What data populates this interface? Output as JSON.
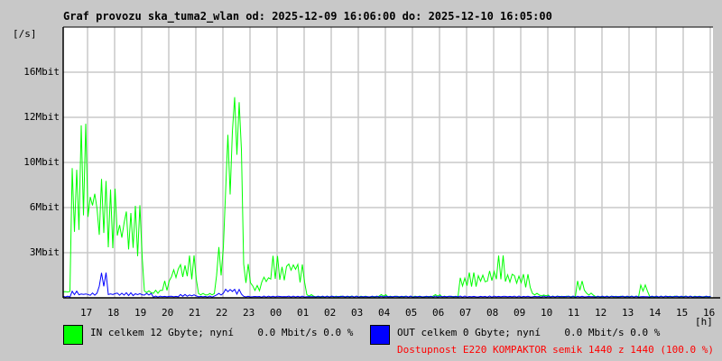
{
  "title": "Graf provozu ska_tuma2_wlan od: 2025-12-09 16:06:00 do: 2025-12-10 16:05:00",
  "colors": {
    "in": "#00ff00",
    "out": "#0000ff",
    "availability": "#ff0000",
    "grid": "#c8c8c8",
    "plot_bg": "#ffffff"
  },
  "chart_data": {
    "type": "line",
    "title": "Graf provozu ska_tuma2_wlan od: 2025-12-09 16:06:00 do: 2025-12-10 16:05:00",
    "ylabel": "[/s]",
    "xlabel": "[h]",
    "ylim": [
      0,
      20
    ],
    "x_tick_labels": [
      "17",
      "18",
      "19",
      "20",
      "21",
      "22",
      "23",
      "00",
      "01",
      "02",
      "03",
      "04",
      "05",
      "06",
      "07",
      "08",
      "09",
      "10",
      "11",
      "12",
      "13",
      "14",
      "15",
      "16"
    ],
    "y_ticks": [
      {
        "label": "3Mbit",
        "value": 3.33
      },
      {
        "label": "6Mbit",
        "value": 6.67
      },
      {
        "label": "10Mbit",
        "value": 10
      },
      {
        "label": "12Mbit",
        "value": 13.33
      },
      {
        "label": "16Mbit",
        "value": 16.67
      }
    ],
    "bin_minutes": 20,
    "grid": true,
    "series": [
      {
        "name": "IN",
        "unit": "Mbit/s",
        "values": [
          0.5,
          8,
          10.5,
          8,
          7.5,
          6.5,
          5.5,
          5.5,
          5.5,
          0.5,
          0.5,
          1,
          2,
          2.2,
          2.5,
          0.3,
          0.3,
          3,
          11,
          14,
          2,
          0.8,
          1.5,
          2.5,
          2,
          2.5,
          2,
          0.2,
          0.1,
          0.1,
          0.1,
          0.1,
          0.1,
          0.1,
          0.1,
          0.2,
          0.1,
          0.1,
          0.1,
          0.1,
          0.1,
          0.2,
          0.1,
          0.1,
          1.3,
          1.5,
          1.6,
          1.8,
          2.5,
          1.6,
          1.5,
          1.4,
          0.3,
          0.2,
          0.1,
          0.1,
          0.1,
          1,
          0.3,
          0.1,
          0.1,
          0.1,
          0.1,
          0.1,
          0.8,
          0.1,
          0.1,
          0.1,
          0.1,
          0.1,
          0.1,
          0.1
        ]
      },
      {
        "name": "OUT",
        "unit": "Mbit/s",
        "values": [
          0.1,
          0.4,
          0.3,
          0.3,
          1.5,
          0.3,
          0.3,
          0.3,
          0.3,
          0.3,
          0.1,
          0.1,
          0.1,
          0.2,
          0.2,
          0.1,
          0.1,
          0.3,
          0.6,
          0.5,
          0.1,
          0.1,
          0.1,
          0.1,
          0.1,
          0.1,
          0.1,
          0.1,
          0.1,
          0.1,
          0.1,
          0.1,
          0.1,
          0.1,
          0.1,
          0.1,
          0.1,
          0.1,
          0.1,
          0.1,
          0.1,
          0.1,
          0.1,
          0.1,
          0.1,
          0.1,
          0.1,
          0.1,
          0.1,
          0.1,
          0.1,
          0.1,
          0.1,
          0.1,
          0.1,
          0.1,
          0.1,
          0.1,
          0.1,
          0.1,
          0.1,
          0.1,
          0.1,
          0.1,
          0.1,
          0.1,
          0.1,
          0.1,
          0.1,
          0.1,
          0.1,
          0.1
        ]
      }
    ]
  },
  "legend": {
    "in_text": "IN celkem 12 Gbyte; nyní    0.0 Mbit/s 0.0 %",
    "out_text": "OUT celkem 0 Gbyte; nyní    0.0 Mbit/s 0.0 %",
    "availability_text": "Dostupnost E220 KOMPAKTOR semik 1440 z 1440 (100.0 %)"
  }
}
